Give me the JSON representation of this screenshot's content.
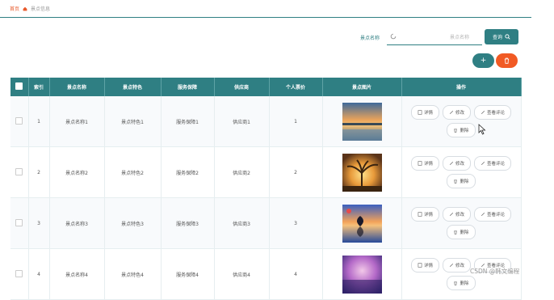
{
  "breadcrumb": {
    "home": "首页",
    "current": "景点信息"
  },
  "search": {
    "label": "景点名称",
    "placeholder": "景点名称",
    "button": "查询"
  },
  "toolbar": {
    "add": "+",
    "delete": "🗑"
  },
  "table": {
    "headers": [
      "",
      "索引",
      "景点名称",
      "景点特色",
      "服务保障",
      "供应商",
      "个人票价",
      "景点图片",
      "操作"
    ],
    "rows": [
      {
        "index": "1",
        "name": "景点名称1",
        "feature": "景点特色1",
        "service": "服务保障1",
        "supplier": "供应商1",
        "price": "1"
      },
      {
        "index": "2",
        "name": "景点名称2",
        "feature": "景点特色2",
        "service": "服务保障2",
        "supplier": "供应商2",
        "price": "2"
      },
      {
        "index": "3",
        "name": "景点名称3",
        "feature": "景点特色3",
        "service": "服务保障3",
        "supplier": "供应商3",
        "price": "3"
      },
      {
        "index": "4",
        "name": "景点名称4",
        "feature": "景点特色4",
        "service": "服务保障4",
        "supplier": "供应商4",
        "price": "4"
      }
    ],
    "actions": {
      "detail": "详情",
      "edit": "修改",
      "review": "查看评论",
      "remove": "删除"
    }
  },
  "watermark": "CSDN @韩文编程",
  "colors": {
    "primary": "#2f7f83",
    "danger": "#f15a24",
    "home": "#e85a2c"
  }
}
